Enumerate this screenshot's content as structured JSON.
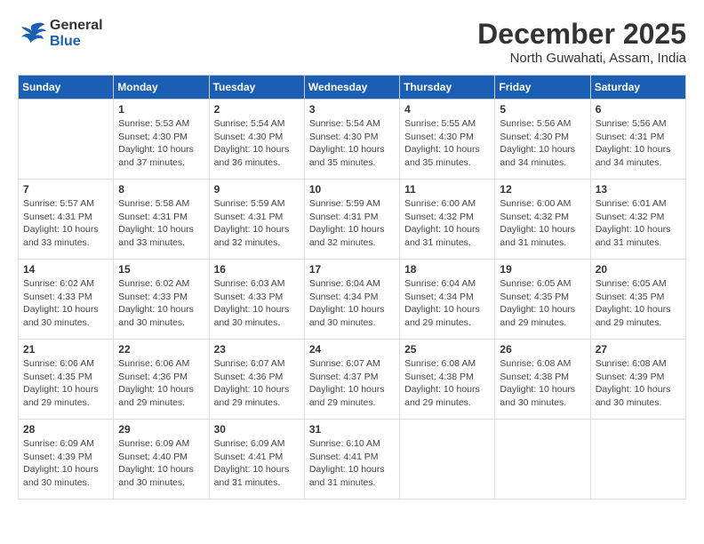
{
  "header": {
    "logo_line1": "General",
    "logo_line2": "Blue",
    "month_year": "December 2025",
    "location": "North Guwahati, Assam, India"
  },
  "days_of_week": [
    "Sunday",
    "Monday",
    "Tuesday",
    "Wednesday",
    "Thursday",
    "Friday",
    "Saturday"
  ],
  "weeks": [
    [
      {
        "day": "",
        "info": ""
      },
      {
        "day": "1",
        "info": "Sunrise: 5:53 AM\nSunset: 4:30 PM\nDaylight: 10 hours\nand 37 minutes."
      },
      {
        "day": "2",
        "info": "Sunrise: 5:54 AM\nSunset: 4:30 PM\nDaylight: 10 hours\nand 36 minutes."
      },
      {
        "day": "3",
        "info": "Sunrise: 5:54 AM\nSunset: 4:30 PM\nDaylight: 10 hours\nand 35 minutes."
      },
      {
        "day": "4",
        "info": "Sunrise: 5:55 AM\nSunset: 4:30 PM\nDaylight: 10 hours\nand 35 minutes."
      },
      {
        "day": "5",
        "info": "Sunrise: 5:56 AM\nSunset: 4:30 PM\nDaylight: 10 hours\nand 34 minutes."
      },
      {
        "day": "6",
        "info": "Sunrise: 5:56 AM\nSunset: 4:31 PM\nDaylight: 10 hours\nand 34 minutes."
      }
    ],
    [
      {
        "day": "7",
        "info": "Sunrise: 5:57 AM\nSunset: 4:31 PM\nDaylight: 10 hours\nand 33 minutes."
      },
      {
        "day": "8",
        "info": "Sunrise: 5:58 AM\nSunset: 4:31 PM\nDaylight: 10 hours\nand 33 minutes."
      },
      {
        "day": "9",
        "info": "Sunrise: 5:59 AM\nSunset: 4:31 PM\nDaylight: 10 hours\nand 32 minutes."
      },
      {
        "day": "10",
        "info": "Sunrise: 5:59 AM\nSunset: 4:31 PM\nDaylight: 10 hours\nand 32 minutes."
      },
      {
        "day": "11",
        "info": "Sunrise: 6:00 AM\nSunset: 4:32 PM\nDaylight: 10 hours\nand 31 minutes."
      },
      {
        "day": "12",
        "info": "Sunrise: 6:00 AM\nSunset: 4:32 PM\nDaylight: 10 hours\nand 31 minutes."
      },
      {
        "day": "13",
        "info": "Sunrise: 6:01 AM\nSunset: 4:32 PM\nDaylight: 10 hours\nand 31 minutes."
      }
    ],
    [
      {
        "day": "14",
        "info": "Sunrise: 6:02 AM\nSunset: 4:33 PM\nDaylight: 10 hours\nand 30 minutes."
      },
      {
        "day": "15",
        "info": "Sunrise: 6:02 AM\nSunset: 4:33 PM\nDaylight: 10 hours\nand 30 minutes."
      },
      {
        "day": "16",
        "info": "Sunrise: 6:03 AM\nSunset: 4:33 PM\nDaylight: 10 hours\nand 30 minutes."
      },
      {
        "day": "17",
        "info": "Sunrise: 6:04 AM\nSunset: 4:34 PM\nDaylight: 10 hours\nand 30 minutes."
      },
      {
        "day": "18",
        "info": "Sunrise: 6:04 AM\nSunset: 4:34 PM\nDaylight: 10 hours\nand 29 minutes."
      },
      {
        "day": "19",
        "info": "Sunrise: 6:05 AM\nSunset: 4:35 PM\nDaylight: 10 hours\nand 29 minutes."
      },
      {
        "day": "20",
        "info": "Sunrise: 6:05 AM\nSunset: 4:35 PM\nDaylight: 10 hours\nand 29 minutes."
      }
    ],
    [
      {
        "day": "21",
        "info": "Sunrise: 6:06 AM\nSunset: 4:35 PM\nDaylight: 10 hours\nand 29 minutes."
      },
      {
        "day": "22",
        "info": "Sunrise: 6:06 AM\nSunset: 4:36 PM\nDaylight: 10 hours\nand 29 minutes."
      },
      {
        "day": "23",
        "info": "Sunrise: 6:07 AM\nSunset: 4:36 PM\nDaylight: 10 hours\nand 29 minutes."
      },
      {
        "day": "24",
        "info": "Sunrise: 6:07 AM\nSunset: 4:37 PM\nDaylight: 10 hours\nand 29 minutes."
      },
      {
        "day": "25",
        "info": "Sunrise: 6:08 AM\nSunset: 4:38 PM\nDaylight: 10 hours\nand 29 minutes."
      },
      {
        "day": "26",
        "info": "Sunrise: 6:08 AM\nSunset: 4:38 PM\nDaylight: 10 hours\nand 30 minutes."
      },
      {
        "day": "27",
        "info": "Sunrise: 6:08 AM\nSunset: 4:39 PM\nDaylight: 10 hours\nand 30 minutes."
      }
    ],
    [
      {
        "day": "28",
        "info": "Sunrise: 6:09 AM\nSunset: 4:39 PM\nDaylight: 10 hours\nand 30 minutes."
      },
      {
        "day": "29",
        "info": "Sunrise: 6:09 AM\nSunset: 4:40 PM\nDaylight: 10 hours\nand 30 minutes."
      },
      {
        "day": "30",
        "info": "Sunrise: 6:09 AM\nSunset: 4:41 PM\nDaylight: 10 hours\nand 31 minutes."
      },
      {
        "day": "31",
        "info": "Sunrise: 6:10 AM\nSunset: 4:41 PM\nDaylight: 10 hours\nand 31 minutes."
      },
      {
        "day": "",
        "info": ""
      },
      {
        "day": "",
        "info": ""
      },
      {
        "day": "",
        "info": ""
      }
    ]
  ]
}
